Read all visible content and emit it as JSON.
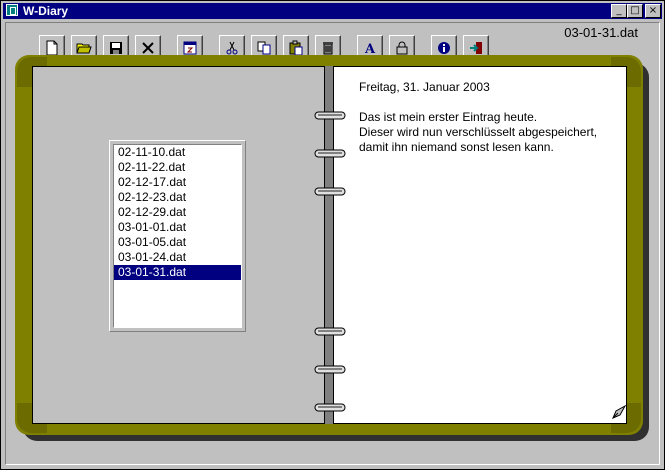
{
  "window": {
    "title": "W-Diary"
  },
  "titlebar_buttons": {
    "minimize": "_",
    "maximize": "□",
    "close": "×"
  },
  "toolbar": {
    "buttons": [
      {
        "name": "new-button",
        "icon": "new-document-icon"
      },
      {
        "name": "open-button",
        "icon": "open-folder-icon"
      },
      {
        "name": "save-button",
        "icon": "save-disk-icon"
      },
      {
        "name": "delete-button",
        "icon": "delete-x-icon"
      },
      {
        "name": "calendar-button",
        "icon": "calendar-icon"
      },
      {
        "name": "cut-button",
        "icon": "scissors-icon"
      },
      {
        "name": "copy-button",
        "icon": "copy-icon"
      },
      {
        "name": "paste-button",
        "icon": "paste-clipboard-icon"
      },
      {
        "name": "trash-button",
        "icon": "trash-can-icon"
      },
      {
        "name": "font-button",
        "icon": "font-a-icon"
      },
      {
        "name": "lock-button",
        "icon": "padlock-icon"
      },
      {
        "name": "info-button",
        "icon": "info-icon"
      },
      {
        "name": "exit-button",
        "icon": "exit-door-icon"
      }
    ]
  },
  "current_file": "03-01-31.dat",
  "files": [
    "02-11-10.dat",
    "02-11-22.dat",
    "02-12-17.dat",
    "02-12-23.dat",
    "02-12-29.dat",
    "03-01-01.dat",
    "03-01-05.dat",
    "03-01-24.dat",
    "03-01-31.dat"
  ],
  "selected_index": 8,
  "entry": {
    "date": "Freitag, 31. Januar 2003",
    "lines": [
      "Das ist mein erster Eintrag heute.",
      "Dieser wird nun verschlüsselt abgespeichert,",
      "damit ihn niemand sonst lesen kann."
    ]
  },
  "colors": {
    "titlebar": "#000080",
    "selection": "#000080",
    "leather": "#808000"
  }
}
